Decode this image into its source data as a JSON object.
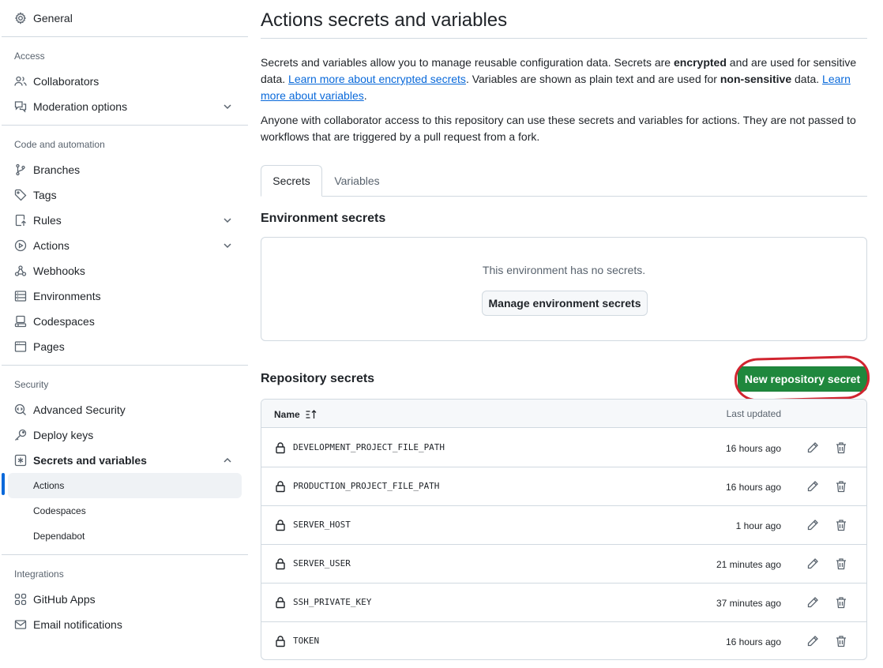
{
  "sidebar": {
    "general": "General",
    "sections": {
      "access": "Access",
      "code_automation": "Code and automation",
      "security": "Security",
      "integrations": "Integrations"
    },
    "items": {
      "collaborators": "Collaborators",
      "moderation": "Moderation options",
      "branches": "Branches",
      "tags": "Tags",
      "rules": "Rules",
      "actions": "Actions",
      "webhooks": "Webhooks",
      "environments": "Environments",
      "codespaces": "Codespaces",
      "pages": "Pages",
      "advanced_security": "Advanced Security",
      "deploy_keys": "Deploy keys",
      "secrets_variables": "Secrets and variables",
      "sub_actions": "Actions",
      "sub_codespaces": "Codespaces",
      "sub_dependabot": "Dependabot",
      "github_apps": "GitHub Apps",
      "email_notifications": "Email notifications"
    }
  },
  "main": {
    "title": "Actions secrets and variables",
    "intro": {
      "t1": "Secrets and variables allow you to manage reusable configuration data. Secrets are ",
      "b1": "encrypted",
      "t2": " and are used for sensitive data. ",
      "link1": "Learn more about encrypted secrets",
      "t3": ". Variables are shown as plain text and are used for ",
      "b2": "non-sensitive",
      "t4": " data. ",
      "link2": "Learn more about variables",
      "t5": "."
    },
    "notice": "Anyone with collaborator access to this repository can use these secrets and variables for actions. They are not passed to workflows that are triggered by a pull request from a fork.",
    "tabs": {
      "secrets": "Secrets",
      "variables": "Variables"
    },
    "env": {
      "title": "Environment secrets",
      "empty": "This environment has no secrets.",
      "manage_button": "Manage environment secrets"
    },
    "repo": {
      "title": "Repository secrets",
      "new_button": "New repository secret",
      "col_name": "Name",
      "col_updated": "Last updated",
      "rows": [
        {
          "name": "DEVELOPMENT_PROJECT_FILE_PATH",
          "updated": "16 hours ago"
        },
        {
          "name": "PRODUCTION_PROJECT_FILE_PATH",
          "updated": "16 hours ago"
        },
        {
          "name": "SERVER_HOST",
          "updated": "1 hour ago"
        },
        {
          "name": "SERVER_USER",
          "updated": "21 minutes ago"
        },
        {
          "name": "SSH_PRIVATE_KEY",
          "updated": "37 minutes ago"
        },
        {
          "name": "TOKEN",
          "updated": "16 hours ago"
        }
      ]
    }
  },
  "colors": {
    "primary_button": "#1f883d",
    "link": "#0969da",
    "active_indicator": "#0969da",
    "highlight_ring": "#d1242f"
  }
}
